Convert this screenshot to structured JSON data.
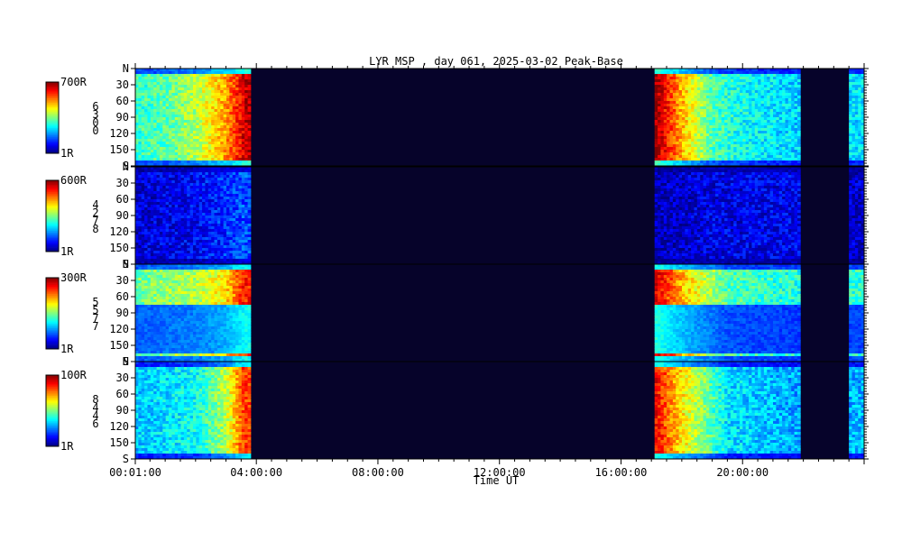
{
  "chart_data": {
    "type": "heatmap",
    "title": "LYR MSP , day 061, 2025-03-02 Peak-Base",
    "xlabel": "Time UT",
    "x_tick_labels": [
      "00:01:00",
      "04:00:00",
      "08:00:00",
      "12:00:00",
      "16:00:00",
      "20:00:00"
    ],
    "x_tick_hours": [
      0.0167,
      4,
      8,
      12,
      16,
      20
    ],
    "x_range_hours": [
      0.0167,
      24
    ],
    "y_range_deg": [
      0,
      180
    ],
    "y_tick_labels": [
      "N",
      "30",
      "60",
      "90",
      "120",
      "150",
      "S"
    ],
    "y_tick_values": [
      0,
      30,
      60,
      90,
      120,
      150,
      180
    ],
    "colormap": "jet",
    "no_data_color": "#06032a",
    "data_intervals_hours": [
      [
        0.0167,
        3.85
      ],
      [
        17.15,
        21.95
      ],
      [
        23.55,
        24.0
      ]
    ],
    "panels": [
      {
        "id": "ch1",
        "max_label": "700R",
        "min_label": "1R",
        "side_digits": [
          "6",
          "3",
          "0",
          "0"
        ],
        "intensity_profile": [
          {
            "t": 0.0,
            "v": 0.42
          },
          {
            "t": 1.0,
            "v": 0.46
          },
          {
            "t": 2.0,
            "v": 0.55
          },
          {
            "t": 3.0,
            "v": 0.72
          },
          {
            "t": 3.6,
            "v": 0.92
          },
          {
            "t": 3.85,
            "v": 0.95
          },
          {
            "t": 17.15,
            "v": 0.97
          },
          {
            "t": 18.0,
            "v": 0.7
          },
          {
            "t": 19.0,
            "v": 0.45
          },
          {
            "t": 20.0,
            "v": 0.38
          },
          {
            "t": 21.95,
            "v": 0.33
          },
          {
            "t": 23.55,
            "v": 0.35
          },
          {
            "t": 24.0,
            "v": 0.35
          }
        ]
      },
      {
        "id": "ch2",
        "max_label": "600R",
        "min_label": "1R",
        "side_digits": [
          "4",
          "2",
          "7",
          "8"
        ],
        "intensity_profile": [
          {
            "t": 0.0,
            "v": 0.08
          },
          {
            "t": 2.0,
            "v": 0.12
          },
          {
            "t": 3.5,
            "v": 0.2
          },
          {
            "t": 3.85,
            "v": 0.2
          },
          {
            "t": 17.15,
            "v": 0.05
          },
          {
            "t": 19.0,
            "v": 0.1
          },
          {
            "t": 21.95,
            "v": 0.11
          },
          {
            "t": 23.55,
            "v": 0.07
          },
          {
            "t": 24.0,
            "v": 0.07
          }
        ]
      },
      {
        "id": "ch3",
        "max_label": "300R",
        "min_label": "1R",
        "side_digits": [
          "5",
          "5",
          "7",
          "7"
        ],
        "intensity_profile": [
          {
            "t": 0.0,
            "v": 0.48
          },
          {
            "t": 2.0,
            "v": 0.55
          },
          {
            "t": 3.0,
            "v": 0.65
          },
          {
            "t": 3.6,
            "v": 0.85
          },
          {
            "t": 3.85,
            "v": 0.85
          },
          {
            "t": 17.15,
            "v": 0.9
          },
          {
            "t": 18.0,
            "v": 0.7
          },
          {
            "t": 19.5,
            "v": 0.45
          },
          {
            "t": 21.95,
            "v": 0.4
          },
          {
            "t": 23.55,
            "v": 0.42
          },
          {
            "t": 24.0,
            "v": 0.42
          }
        ]
      },
      {
        "id": "ch4",
        "max_label": "100R",
        "min_label": "1R",
        "side_digits": [
          "8",
          "4",
          "4",
          "6"
        ],
        "intensity_profile": [
          {
            "t": 0.0,
            "v": 0.32
          },
          {
            "t": 2.0,
            "v": 0.38
          },
          {
            "t": 3.0,
            "v": 0.55
          },
          {
            "t": 3.6,
            "v": 0.82
          },
          {
            "t": 3.85,
            "v": 0.82
          },
          {
            "t": 17.15,
            "v": 0.88
          },
          {
            "t": 18.0,
            "v": 0.65
          },
          {
            "t": 19.5,
            "v": 0.35
          },
          {
            "t": 21.95,
            "v": 0.28
          },
          {
            "t": 23.55,
            "v": 0.3
          },
          {
            "t": 24.0,
            "v": 0.3
          }
        ]
      }
    ]
  }
}
